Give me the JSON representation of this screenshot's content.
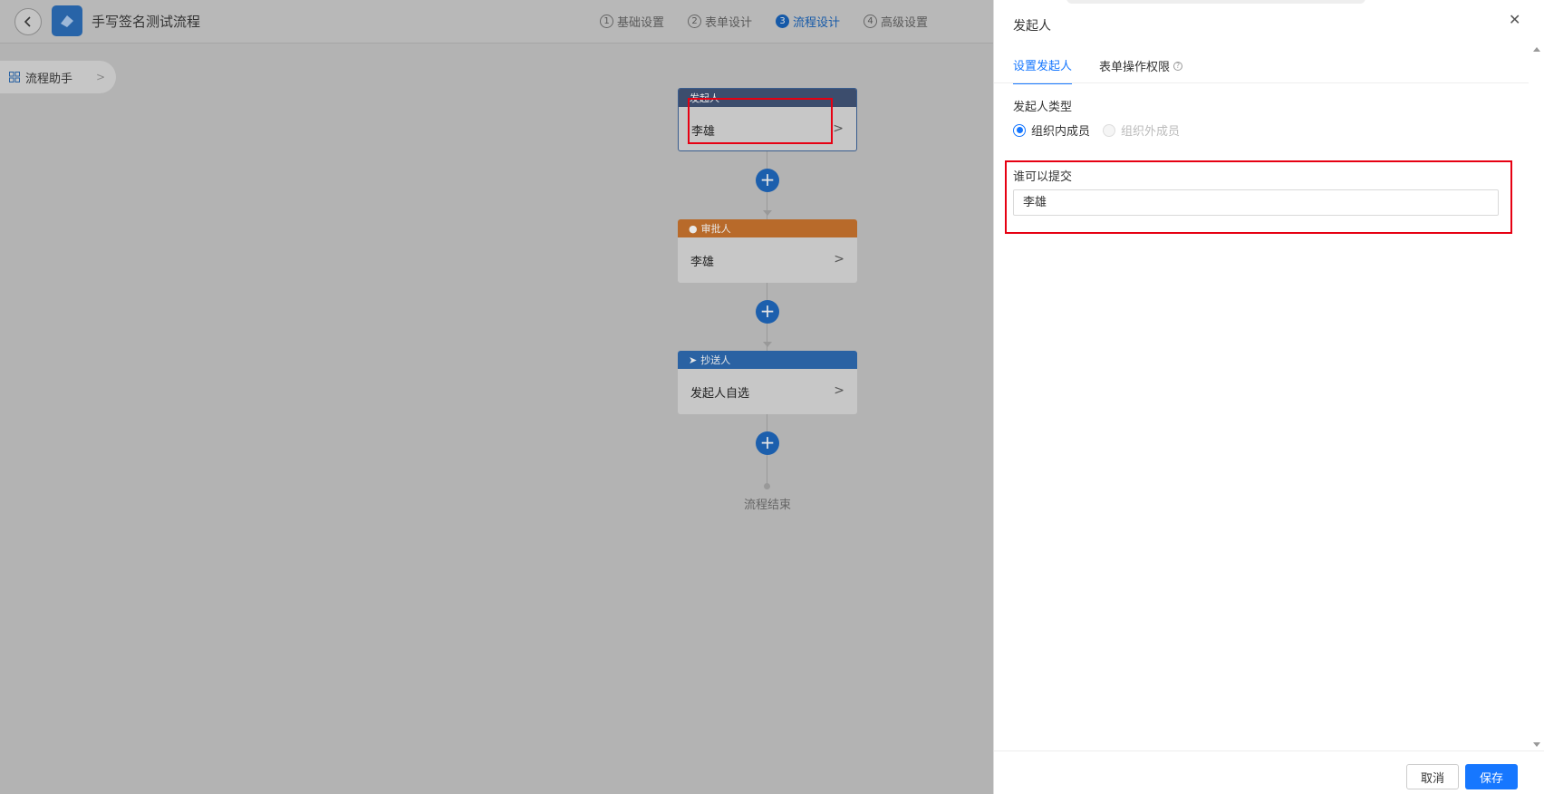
{
  "header": {
    "title": "手写签名测试流程",
    "steps": [
      {
        "num": "1",
        "label": "基础设置"
      },
      {
        "num": "2",
        "label": "表单设计"
      },
      {
        "num": "3",
        "label": "流程设计"
      },
      {
        "num": "4",
        "label": "高级设置"
      }
    ]
  },
  "assistant": {
    "label": "流程助手"
  },
  "flow": {
    "initiator": {
      "head": "发起人",
      "value": "李雄"
    },
    "approver": {
      "head": "审批人",
      "value": "李雄"
    },
    "cc": {
      "head": "抄送人",
      "value": "发起人自选"
    },
    "end_label": "流程结束"
  },
  "panel": {
    "title": "发起人",
    "tabs": [
      "设置发起人",
      "表单操作权限"
    ],
    "initiator_type_label": "发起人类型",
    "radios": [
      {
        "label": "组织内成员",
        "checked": true
      },
      {
        "label": "组织外成员",
        "checked": false
      }
    ],
    "submit_label": "谁可以提交",
    "submit_value": "李雄",
    "cancel_label": "取消",
    "save_label": "保存"
  },
  "colors": {
    "accent": "#1677ff",
    "highlight": "#e60012",
    "approver_head": "#b86a2a",
    "cc_head": "#2a62a3",
    "initiator_head": "#3c4d6d"
  }
}
